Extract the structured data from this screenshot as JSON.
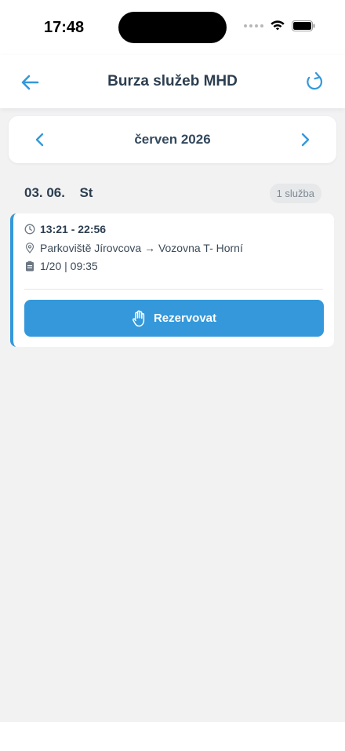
{
  "status_bar": {
    "time": "17:48"
  },
  "header": {
    "title": "Burza služeb MHD"
  },
  "month_nav": {
    "label": "červen 2026"
  },
  "day": {
    "date": "03. 06.",
    "weekday": "St",
    "count_label": "1 služba"
  },
  "shift": {
    "time_range": "13:21 - 22:56",
    "route": "Parkoviště Jírovcova → Vozovna T- Horní",
    "duty": "1/20 | 09:35",
    "reserve_label": "Rezervovat"
  },
  "colors": {
    "accent": "#3498db",
    "background": "#f2f2f3",
    "title": "#2c3e50"
  },
  "icons": [
    "back-arrow-icon",
    "refresh-icon",
    "chevron-left-icon",
    "chevron-right-icon",
    "clock-icon",
    "location-pin-icon",
    "clipboard-icon",
    "hand-icon",
    "wifi-icon",
    "battery-icon",
    "signal-icon"
  ]
}
